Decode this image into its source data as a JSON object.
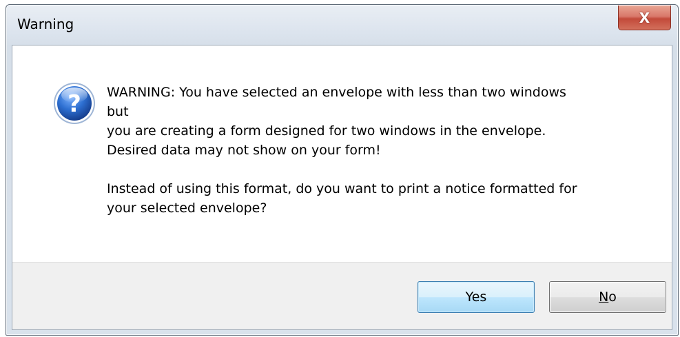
{
  "window": {
    "title": "Warning",
    "close_label": "X"
  },
  "dialog": {
    "icon": "question-icon",
    "message_lines": [
      "WARNING: You have selected an envelope with less than two windows",
      "but",
      "you are creating a form designed for two windows in the envelope.",
      "Desired data may not show on your form!",
      "Instead of using this format, do you want to print a notice formatted for",
      "your selected envelope?"
    ]
  },
  "buttons": {
    "yes_label": "Yes",
    "no_mnemonic": "N",
    "no_rest": "o"
  },
  "colors": {
    "close_button": "#c24a3a",
    "default_button_border": "#3c7fb1",
    "icon_blue": "#1f5fbf"
  }
}
